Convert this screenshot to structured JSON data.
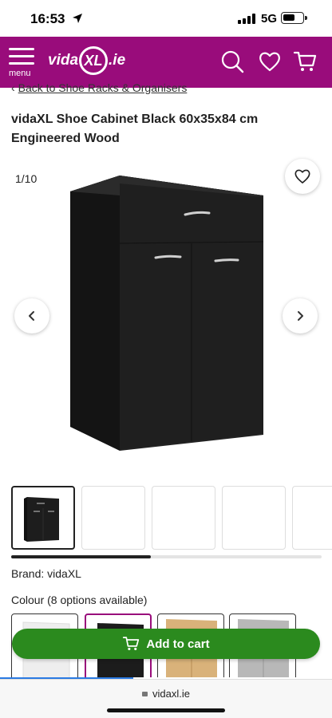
{
  "status_bar": {
    "time": "16:53",
    "network": "5G"
  },
  "header": {
    "menu_label": "menu",
    "logo": {
      "left": "vida",
      "mark": "XL",
      "right": ".ie"
    },
    "icons": [
      "search-icon",
      "heart-icon",
      "cart-icon"
    ],
    "brand_color": "#990c7b"
  },
  "breadcrumb": {
    "text": "Back to Shoe Racks & Organisers"
  },
  "product": {
    "title": "vidaXL Shoe Cabinet Black 60x35x84 cm Engineered Wood",
    "image_counter": "1/10",
    "brand": "Brand: vidaXL",
    "colour_label": "Colour (8 options available)"
  },
  "gallery": {
    "thumbnail_count_visible": 5,
    "scroll_progress": 0.45
  },
  "swatches": [
    {
      "name": "White",
      "color": "#f2f2f2"
    },
    {
      "name": "Black",
      "color": "#1c1c1c",
      "selected": true
    },
    {
      "name": "Sonoma Oak",
      "color": "#d9b27a"
    },
    {
      "name": "Concrete Grey",
      "color": "#b8b8b8"
    }
  ],
  "cart": {
    "label": "Add to cart",
    "color": "#2b8a1e"
  },
  "browser": {
    "url": "vidaxl.ie"
  }
}
